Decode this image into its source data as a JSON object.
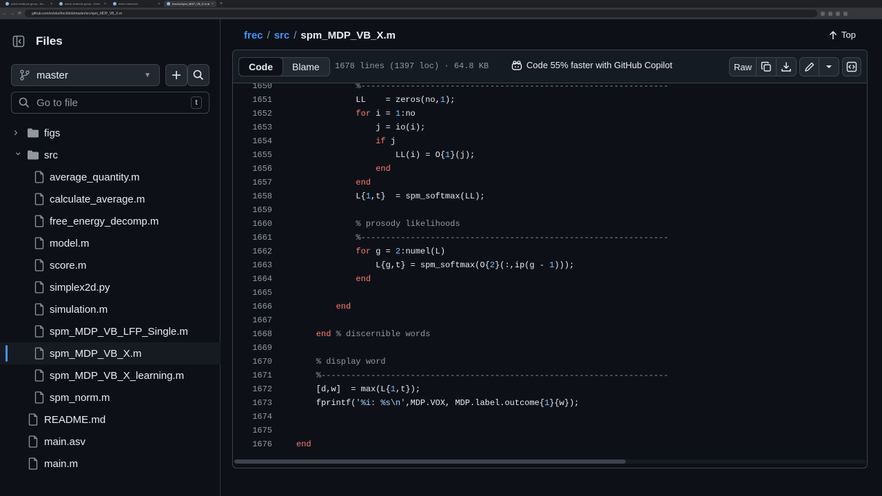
{
  "browser": {
    "tabs": [
      {
        "title": "active textbook group - No..."
      },
      {
        "title": "active textbook group - Drive"
      },
      {
        "title": "active inference"
      },
      {
        "title": "frec/src/spm_MDP_VB_X.m at..."
      }
    ],
    "url": "github.com/ecleks/frec/blob/master/src/spm_MDP_VB_X.m"
  },
  "sidebar": {
    "title": "Files",
    "branch": "master",
    "search_placeholder": "Go to file",
    "search_shortcut": "t",
    "tree": [
      {
        "label": "figs",
        "type": "folder",
        "expanded": false,
        "depth": 0
      },
      {
        "label": "src",
        "type": "folder",
        "expanded": true,
        "depth": 0
      },
      {
        "label": "average_quantity.m",
        "type": "file",
        "depth": 1
      },
      {
        "label": "calculate_average.m",
        "type": "file",
        "depth": 1
      },
      {
        "label": "free_energy_decomp.m",
        "type": "file",
        "depth": 1
      },
      {
        "label": "model.m",
        "type": "file",
        "depth": 1
      },
      {
        "label": "score.m",
        "type": "file",
        "depth": 1
      },
      {
        "label": "simplex2d.py",
        "type": "file",
        "depth": 1
      },
      {
        "label": "simulation.m",
        "type": "file",
        "depth": 1
      },
      {
        "label": "spm_MDP_VB_LFP_Single.m",
        "type": "file",
        "depth": 1
      },
      {
        "label": "spm_MDP_VB_X.m",
        "type": "file",
        "depth": 1,
        "selected": true
      },
      {
        "label": "spm_MDP_VB_X_learning.m",
        "type": "file",
        "depth": 1
      },
      {
        "label": "spm_norm.m",
        "type": "file",
        "depth": 1
      },
      {
        "label": "README.md",
        "type": "file",
        "depth": 0
      },
      {
        "label": "main.asv",
        "type": "file",
        "depth": 0
      },
      {
        "label": "main.m",
        "type": "file",
        "depth": 0
      }
    ]
  },
  "main": {
    "breadcrumb": {
      "repo": "frec",
      "folder": "src",
      "file": "spm_MDP_VB_X.m",
      "sep": "/"
    },
    "top_label": "Top",
    "tabs": {
      "code": "Code",
      "blame": "Blame"
    },
    "file_info": "1678 lines (1397 loc) · 64.8 KB",
    "copilot": "Code 55% faster with GitHub Copilot",
    "raw_label": "Raw",
    "scroll_fraction": 0.62
  },
  "code": [
    {
      "n": "1650",
      "t": [
        [
          "c",
          "            %--------------------------------------------------------------"
        ]
      ]
    },
    {
      "n": "1651",
      "t": [
        [
          "",
          "            LL    = zeros(no,"
        ],
        [
          "n",
          "1"
        ],
        [
          "",
          ");"
        ]
      ]
    },
    {
      "n": "1652",
      "t": [
        [
          "k",
          "            for"
        ],
        [
          "",
          " i = "
        ],
        [
          "n",
          "1"
        ],
        [
          "",
          ":no"
        ]
      ]
    },
    {
      "n": "1653",
      "t": [
        [
          "",
          "                j = io(i);"
        ]
      ]
    },
    {
      "n": "1654",
      "t": [
        [
          "k",
          "                if"
        ],
        [
          "",
          " j"
        ]
      ]
    },
    {
      "n": "1655",
      "t": [
        [
          "",
          "                    LL(i) = O{"
        ],
        [
          "n",
          "1"
        ],
        [
          "",
          "}(j);"
        ]
      ]
    },
    {
      "n": "1656",
      "t": [
        [
          "k",
          "                end"
        ]
      ]
    },
    {
      "n": "1657",
      "t": [
        [
          "k",
          "            end"
        ]
      ]
    },
    {
      "n": "1658",
      "t": [
        [
          "",
          "            L{"
        ],
        [
          "n",
          "1"
        ],
        [
          "",
          ",t}  = spm_softmax(LL);"
        ]
      ]
    },
    {
      "n": "1659",
      "t": [
        [
          "",
          ""
        ]
      ]
    },
    {
      "n": "1660",
      "t": [
        [
          "c",
          "            % prosody likelihoods"
        ]
      ]
    },
    {
      "n": "1661",
      "t": [
        [
          "c",
          "            %--------------------------------------------------------------"
        ]
      ]
    },
    {
      "n": "1662",
      "t": [
        [
          "k",
          "            for"
        ],
        [
          "",
          " g = "
        ],
        [
          "n",
          "2"
        ],
        [
          "",
          ":numel(L)"
        ]
      ]
    },
    {
      "n": "1663",
      "t": [
        [
          "",
          "                L{g,t} = spm_softmax(O{"
        ],
        [
          "n",
          "2"
        ],
        [
          "",
          "}(:,ip(g - "
        ],
        [
          "n",
          "1"
        ],
        [
          "",
          ")));"
        ]
      ]
    },
    {
      "n": "1664",
      "t": [
        [
          "k",
          "            end"
        ]
      ]
    },
    {
      "n": "1665",
      "t": [
        [
          "",
          ""
        ]
      ]
    },
    {
      "n": "1666",
      "t": [
        [
          "k",
          "        end"
        ]
      ]
    },
    {
      "n": "1667",
      "t": [
        [
          "",
          ""
        ]
      ]
    },
    {
      "n": "1668",
      "t": [
        [
          "k",
          "    end"
        ],
        [
          "c",
          " % discernible words"
        ]
      ]
    },
    {
      "n": "1669",
      "t": [
        [
          "",
          ""
        ]
      ]
    },
    {
      "n": "1670",
      "t": [
        [
          "c",
          "    % display word"
        ]
      ]
    },
    {
      "n": "1671",
      "t": [
        [
          "c",
          "    %----------------------------------------------------------------------"
        ]
      ]
    },
    {
      "n": "1672",
      "t": [
        [
          "",
          "    [d,w]  = max(L{"
        ],
        [
          "n",
          "1"
        ],
        [
          "",
          ",t});"
        ]
      ]
    },
    {
      "n": "1673",
      "t": [
        [
          "",
          "    fprintf("
        ],
        [
          "s",
          "'%i: %s\\n'"
        ],
        [
          "",
          ",MDP.VOX, MDP.label.outcome{"
        ],
        [
          "n",
          "1"
        ],
        [
          "",
          "}{w});"
        ]
      ]
    },
    {
      "n": "1674",
      "t": [
        [
          "",
          ""
        ]
      ]
    },
    {
      "n": "1675",
      "t": [
        [
          "",
          ""
        ]
      ]
    },
    {
      "n": "1676",
      "t": [
        [
          "k",
          "end"
        ]
      ]
    }
  ]
}
